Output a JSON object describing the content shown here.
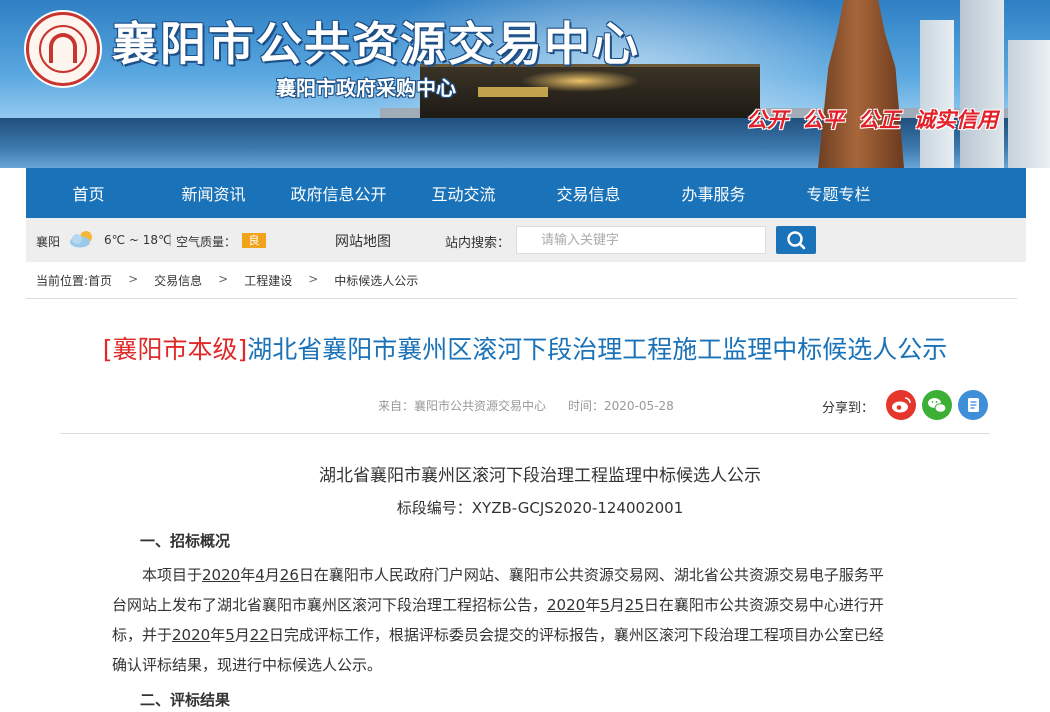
{
  "header": {
    "site_title": "襄阳市公共资源交易中心",
    "site_subtitle": "襄阳市政府采购中心",
    "slogans": [
      "公开",
      "公平",
      "公正",
      "诚实信用"
    ]
  },
  "nav": {
    "items": [
      "首页",
      "新闻资讯",
      "政府信息公开",
      "互动交流",
      "交易信息",
      "办事服务",
      "专题专栏"
    ]
  },
  "toolbar": {
    "city": "襄阳",
    "weather_icon": "partly-cloudy-icon",
    "temperature": "6℃ ~ 18℃",
    "separator": "|",
    "air_quality_label": "空气质量：",
    "air_quality_value": "良",
    "sitemap": "网站地图",
    "search_label": "站内搜索：",
    "search_placeholder": "请输入关键字",
    "search_icon": "search-icon"
  },
  "breadcrumb": {
    "label": "当前位置: ",
    "items": [
      "首页",
      "交易信息",
      "工程建设",
      "中标候选人公示"
    ],
    "separator": ">"
  },
  "article": {
    "tag": "[襄阳市本级]",
    "title": "湖北省襄阳市襄州区滚河下段治理工程施工监理中标候选人公示",
    "source": "来自：襄阳市公共资源交易中心",
    "time": "时间：2020-05-28",
    "share_label": "分享到：",
    "share_icons": [
      "weibo-icon",
      "wechat-icon",
      "document-icon"
    ],
    "doc_title": "湖北省襄阳市襄州区滚河下段治理工程监理中标候选人公示",
    "doc_code": "标段编号：XYZB-GCJS2020-124002001",
    "section1_heading": "一、招标概况",
    "para1": {
      "s1": "本项目于",
      "u1": "2020",
      "s2": "年",
      "u2": "4",
      "s3": "月",
      "u3": "26",
      "s4": "日在襄阳市人民政府门户网站、襄阳市公共资源交易网、湖北省公共资源交易电子服务平",
      "s5": "台网站上发布了湖北省襄阳市襄州区滚河下段治理工程招标公告，",
      "u4": "2020",
      "s6": "年",
      "u5": "5",
      "s7": "月",
      "u6": "25",
      "s8": "日在襄阳市公共资源交易中心进行开",
      "s9": "标，并于",
      "u7": "2020",
      "s10": "年",
      "u8": "5",
      "s11": "月",
      "u9": "22",
      "s12": "日完成评标工作，根据评标委员会提交的评标报告，襄州区滚河下段治理工程项目办公室已经",
      "s13": "确认评标结果，现进行中标候选人公示。"
    },
    "section2_heading": "二、评标结果"
  }
}
